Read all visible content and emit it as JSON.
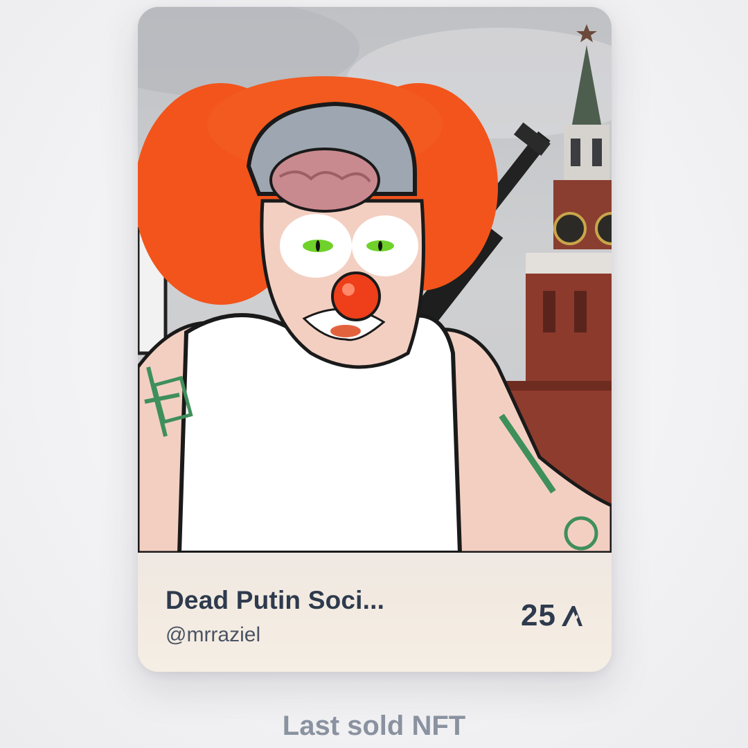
{
  "card": {
    "title": "Dead Putin Soci...",
    "creator": "@mrraziel",
    "price": "25",
    "currency_icon": "algorand-icon"
  },
  "caption": "Last sold NFT",
  "colors": {
    "title_text": "#2e3a4d",
    "creator_text": "#4a5364",
    "caption_text": "#8a92a0",
    "card_footer": "#f3ebe1",
    "page_background": "#f3f3f5"
  }
}
